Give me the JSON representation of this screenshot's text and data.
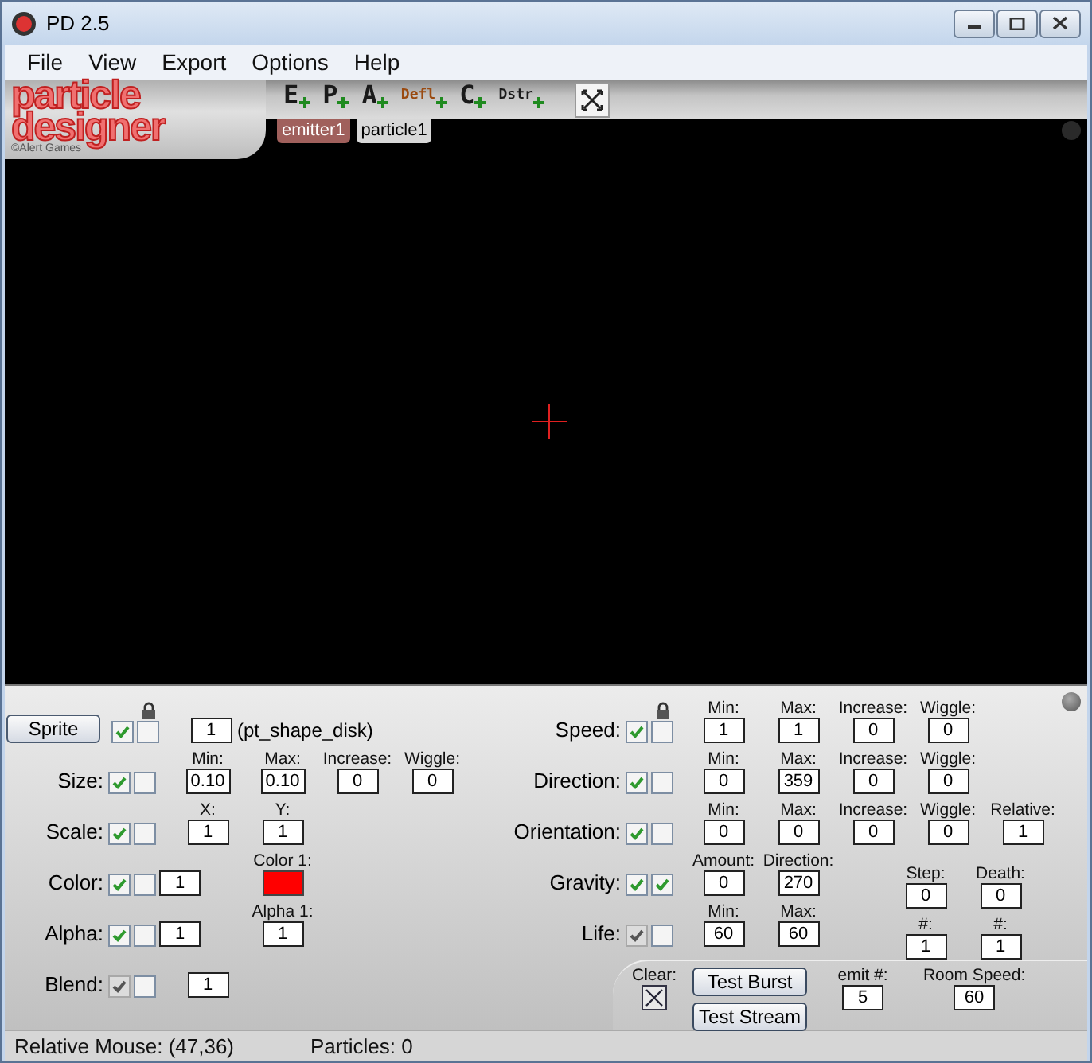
{
  "window": {
    "title": "PD 2.5"
  },
  "menu": [
    "File",
    "View",
    "Export",
    "Options",
    "Help"
  ],
  "logo": {
    "line_1": "particle",
    "line_2": "designer",
    "credit": "©Alert Games"
  },
  "toolbar": [
    {
      "label": "E",
      "kind": "letter",
      "color": "#1a1a1a"
    },
    {
      "label": "P",
      "kind": "letter",
      "color": "#1a1a1a"
    },
    {
      "label": "A",
      "kind": "letter",
      "color": "#1a1a1a"
    },
    {
      "label": "Defl",
      "kind": "small",
      "color": "#9a4a10"
    },
    {
      "label": "C",
      "kind": "letter",
      "color": "#1a1a1a"
    },
    {
      "label": "Dstr",
      "kind": "small",
      "color": "#1a1a1a"
    }
  ],
  "tabs": [
    {
      "label": "emitter1",
      "selected": true
    },
    {
      "label": "particle1",
      "selected": false
    }
  ],
  "left_rows": [
    {
      "label": "Sprite",
      "kind": "button",
      "checks": [
        {
          "checked": true,
          "disabled": false
        },
        {
          "checked": false,
          "disabled": false
        }
      ],
      "cells": [
        {
          "kind": "field",
          "value": "1"
        },
        {
          "kind": "text",
          "value": "(pt_shape_disk)"
        }
      ]
    },
    {
      "label": "Size:",
      "kind": "label",
      "checks": [
        {
          "checked": true,
          "disabled": false
        },
        {
          "checked": false,
          "disabled": false
        }
      ],
      "cells": [
        {
          "kind": "field",
          "heading": "Min:",
          "value": "0.10"
        },
        {
          "kind": "field",
          "heading": "Max:",
          "value": "0.10"
        },
        {
          "kind": "field",
          "heading": "Increase:",
          "value": "0"
        },
        {
          "kind": "field",
          "heading": "Wiggle:",
          "value": "0"
        }
      ]
    },
    {
      "label": "Scale:",
      "kind": "label",
      "checks": [
        {
          "checked": true,
          "disabled": false
        },
        {
          "checked": false,
          "disabled": false
        }
      ],
      "cells": [
        {
          "kind": "field",
          "heading": "X:",
          "value": "1"
        },
        {
          "kind": "field",
          "heading": "Y:",
          "value": "1"
        }
      ]
    },
    {
      "label": "Color:",
      "kind": "label",
      "checks": [
        {
          "checked": true,
          "disabled": false
        },
        {
          "checked": false,
          "disabled": false
        }
      ],
      "count": "1",
      "cells": [
        {
          "kind": "swatch",
          "heading": "Color 1:",
          "color": "#ff0000"
        }
      ]
    },
    {
      "label": "Alpha:",
      "kind": "label",
      "checks": [
        {
          "checked": true,
          "disabled": false
        },
        {
          "checked": false,
          "disabled": false
        }
      ],
      "count": "1",
      "cells": [
        {
          "kind": "field",
          "heading": "Alpha 1:",
          "value": "1"
        }
      ]
    },
    {
      "label": "Blend:",
      "kind": "label",
      "checks": [
        {
          "checked": true,
          "disabled": true
        },
        {
          "checked": false,
          "disabled": false
        }
      ],
      "cells": [
        {
          "kind": "field",
          "value": "1"
        }
      ]
    }
  ],
  "right_rows": [
    {
      "label": "Speed:",
      "kind": "label",
      "checks": [
        {
          "checked": true,
          "disabled": false
        },
        {
          "checked": false,
          "disabled": false
        }
      ],
      "cells": [
        {
          "kind": "field",
          "heading": "Min:",
          "value": "1"
        },
        {
          "kind": "field",
          "heading": "Max:",
          "value": "1"
        },
        {
          "kind": "field",
          "heading": "Increase:",
          "value": "0"
        },
        {
          "kind": "field",
          "heading": "Wiggle:",
          "value": "0"
        }
      ]
    },
    {
      "label": "Direction:",
      "kind": "label",
      "checks": [
        {
          "checked": true,
          "disabled": false
        },
        {
          "checked": false,
          "disabled": false
        }
      ],
      "cells": [
        {
          "kind": "field",
          "heading": "Min:",
          "value": "0"
        },
        {
          "kind": "field",
          "heading": "Max:",
          "value": "359"
        },
        {
          "kind": "field",
          "heading": "Increase:",
          "value": "0"
        },
        {
          "kind": "field",
          "heading": "Wiggle:",
          "value": "0"
        }
      ]
    },
    {
      "label": "Orientation:",
      "kind": "label",
      "checks": [
        {
          "checked": true,
          "disabled": false
        },
        {
          "checked": false,
          "disabled": false
        }
      ],
      "cells": [
        {
          "kind": "field",
          "heading": "Min:",
          "value": "0"
        },
        {
          "kind": "field",
          "heading": "Max:",
          "value": "0"
        },
        {
          "kind": "field",
          "heading": "Increase:",
          "value": "0"
        },
        {
          "kind": "field",
          "heading": "Wiggle:",
          "value": "0"
        },
        {
          "kind": "field",
          "heading": "Relative:",
          "value": "1"
        }
      ]
    },
    {
      "label": "Gravity:",
      "kind": "label",
      "checks": [
        {
          "checked": true,
          "disabled": false
        },
        {
          "checked": true,
          "disabled": false
        }
      ],
      "cells": [
        {
          "kind": "field",
          "heading": "Amount:",
          "value": "0"
        },
        {
          "kind": "field",
          "heading": "Direction:",
          "value": "270"
        }
      ],
      "extras": [
        {
          "kind": "field",
          "heading": "Step:",
          "value": "0"
        },
        {
          "kind": "field",
          "heading": "Death:",
          "value": "0"
        }
      ]
    },
    {
      "label": "Life:",
      "kind": "label",
      "checks": [
        {
          "checked": true,
          "disabled": true
        },
        {
          "checked": false,
          "disabled": false
        }
      ],
      "cells": [
        {
          "kind": "field",
          "heading": "Min:",
          "value": "60"
        },
        {
          "kind": "field",
          "heading": "Max:",
          "value": "60"
        }
      ],
      "extras": [
        {
          "kind": "field",
          "heading": "#:",
          "value": "1"
        },
        {
          "kind": "field",
          "heading": "#:",
          "value": "1"
        }
      ]
    }
  ],
  "footer": {
    "clear_label": "Clear:",
    "buttons": [
      "Test Burst",
      "Test Stream"
    ],
    "fields": [
      {
        "heading": "emit #:",
        "value": "5"
      },
      {
        "heading": "Room Speed:",
        "value": "60"
      }
    ]
  },
  "status_bar": {
    "mouse": "Relative Mouse: (47,36)",
    "particles": "Particles: 0"
  }
}
